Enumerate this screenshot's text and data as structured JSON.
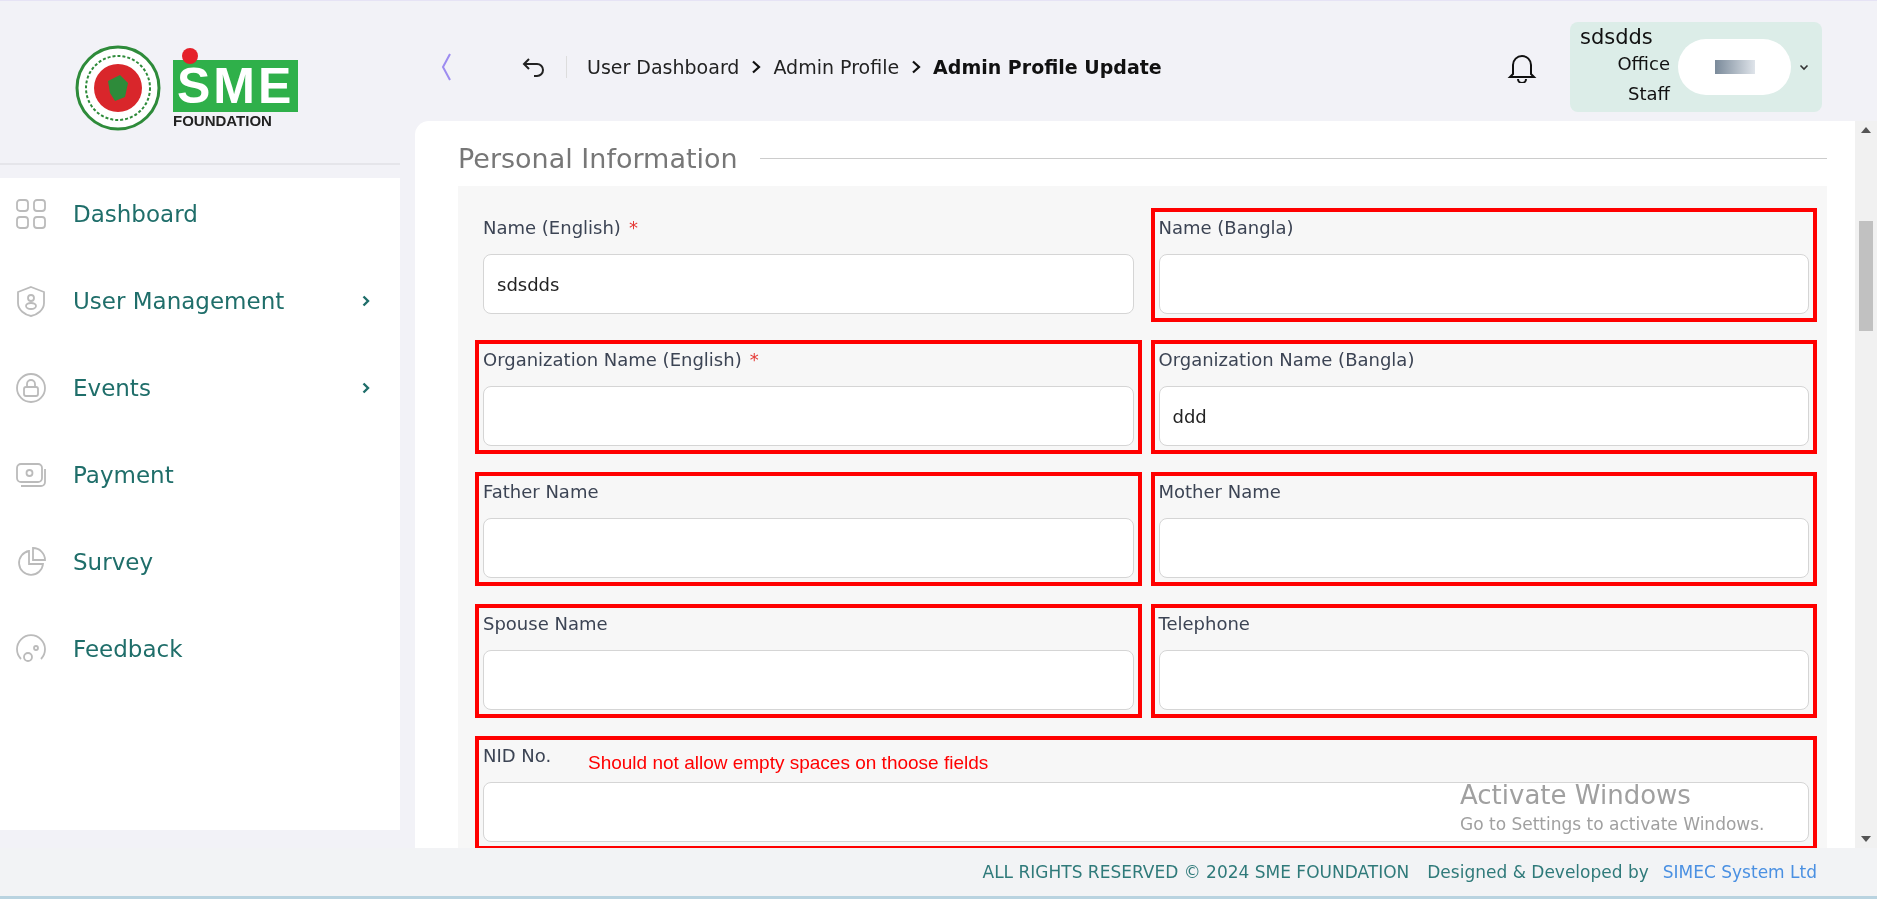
{
  "logo": {
    "wordmark": "SME",
    "subtext": "FOUNDATION"
  },
  "header": {
    "breadcrumbs": [
      {
        "label": "User Dashboard",
        "current": false
      },
      {
        "label": "Admin Profile",
        "current": false
      },
      {
        "label": "Admin Profile Update",
        "current": true
      }
    ],
    "user": {
      "name": "sdsdds",
      "role": "Office Staff"
    }
  },
  "sidebar": {
    "items": [
      {
        "label": "Dashboard",
        "has_submenu": false
      },
      {
        "label": "User Management",
        "has_submenu": true
      },
      {
        "label": "Events",
        "has_submenu": true
      },
      {
        "label": "Payment",
        "has_submenu": false
      },
      {
        "label": "Survey",
        "has_submenu": false
      },
      {
        "label": "Feedback",
        "has_submenu": false
      }
    ]
  },
  "section": {
    "title": "Personal Information",
    "fields": [
      {
        "label": "Name (English)",
        "required_mark": "*",
        "value": "sdsdds",
        "flagged": false
      },
      {
        "label": "Name (Bangla)",
        "flagged": true
      },
      {
        "label": "Organization Name (English)",
        "required_mark": "*",
        "flagged": true
      },
      {
        "label": "Organization Name (Bangla)",
        "value": "ddd",
        "flagged": true
      },
      {
        "label": "Father Name",
        "flagged": true
      },
      {
        "label": "Mother Name",
        "flagged": true
      },
      {
        "label": "Spouse Name",
        "flagged": true
      },
      {
        "label": "Telephone",
        "flagged": true
      },
      {
        "label": "NID No.",
        "flagged": true,
        "wide": true
      }
    ]
  },
  "annotations": {
    "note": "Should not allow empty spaces on thoose fields"
  },
  "os_watermark": {
    "title": "Activate Windows",
    "subtitle": "Go to Settings to activate Windows."
  },
  "footer": {
    "copyright": "ALL RIGHTS RESERVED © 2024 SME FOUNDATION",
    "credit": "Designed & Developed by",
    "credit_link": "SIMEC System Ltd"
  }
}
